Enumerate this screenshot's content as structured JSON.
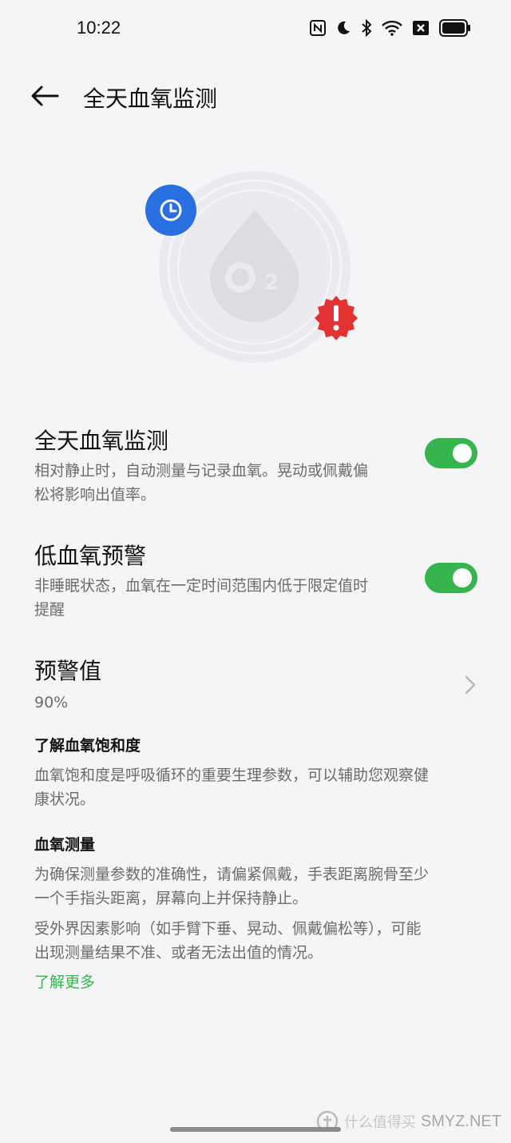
{
  "status_bar": {
    "time": "10:22",
    "icons": [
      "nfc-icon",
      "moon-icon",
      "bluetooth-icon",
      "wifi-icon",
      "sim-off-icon",
      "battery-icon"
    ]
  },
  "header": {
    "back_icon": "arrow-left-icon",
    "title": "全天血氧监测"
  },
  "hero": {
    "badge_left_icon": "clock-icon",
    "center_icon": "o2-drop-icon",
    "center_text": "O2",
    "badge_right_icon": "exclamation-icon"
  },
  "settings": {
    "all_day": {
      "title": "全天血氧监测",
      "desc_line1": "相对静止时，自动测量与记录血氧。晃动或佩戴偏",
      "desc_line2": "松将影响出值率。",
      "enabled": true
    },
    "low_alert": {
      "title": "低血氧预警",
      "desc_line1": "非睡眠状态，血氧在一定时间范围内低于限定值时",
      "desc_line2": "提醒",
      "enabled": true
    },
    "threshold": {
      "title": "预警值",
      "value": "90%"
    }
  },
  "info": {
    "saturation": {
      "heading": "了解血氧饱和度",
      "line1": "血氧饱和度是呼吸循环的重要生理参数，可以辅助您观察健",
      "line2": "康状况。"
    },
    "measurement": {
      "heading": "血氧测量",
      "p1_line1": "为确保测量参数的准确性，请偏紧佩戴，手表距离腕骨至少",
      "p1_line2": "一个手指头距离，屏幕向上并保持静止。",
      "p2_line1": "受外界因素影响（如手臂下垂、晃动、佩戴偏松等），可能",
      "p2_line2": "出现测量结果不准、或者无法出值的情况。"
    },
    "learn_more": "了解更多"
  },
  "watermark": {
    "text": "SMYZ.NET",
    "cn": "什么值得买"
  },
  "colors": {
    "background": "#f5f5f7",
    "accent_green": "#36b44e",
    "badge_blue": "#2a6fe0",
    "badge_red": "#e33232"
  }
}
